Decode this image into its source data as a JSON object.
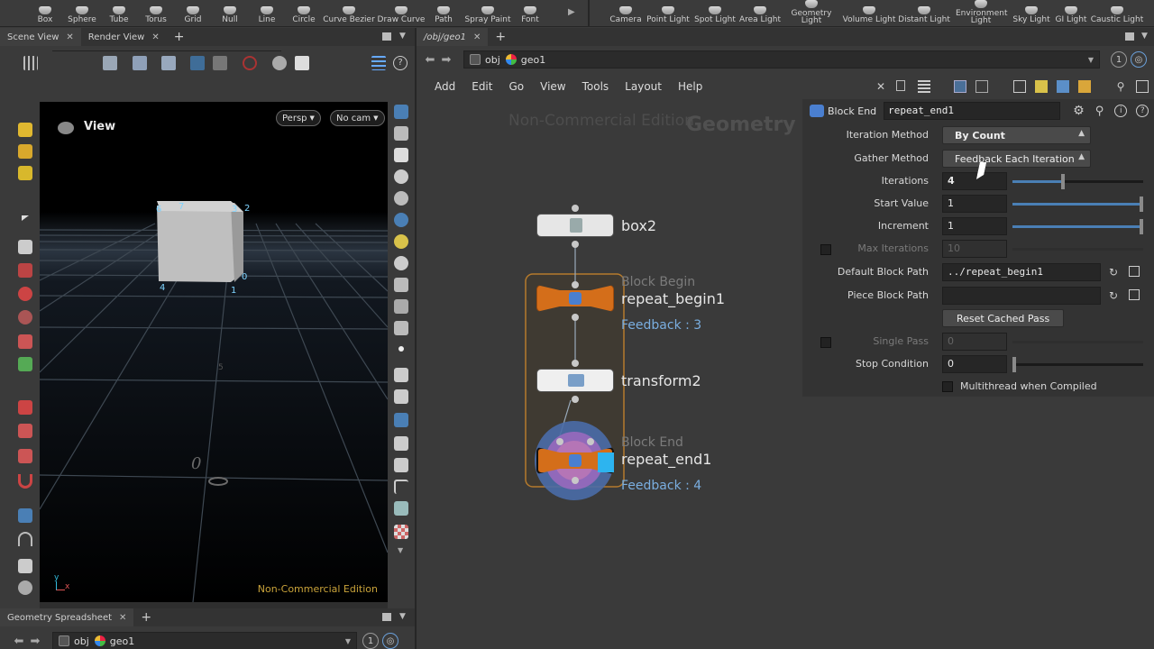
{
  "shelf": {
    "tools": [
      "Box",
      "Sphere",
      "Tube",
      "Torus",
      "Grid",
      "Null",
      "Line",
      "Circle",
      "Curve Bezier",
      "Draw Curve",
      "Path",
      "Spray Paint",
      "Font"
    ],
    "lights": [
      "Camera",
      "Point Light",
      "Spot Light",
      "Area Light",
      "Geometry Light",
      "Volume Light",
      "Distant Light",
      "Environment Light",
      "Sky Light",
      "GI Light",
      "Caustic Light"
    ]
  },
  "left_panel": {
    "tabs": [
      {
        "label": "Scene View"
      },
      {
        "label": "Render View"
      }
    ],
    "path": {
      "root": "obj",
      "node": "geo1",
      "circle": "1"
    },
    "viewport": {
      "label": "View",
      "persp": "Persp",
      "cam": "No cam",
      "watermark": "Non-Commercial Edition",
      "axis_y": "y",
      "axis_x": "x",
      "points": [
        "6",
        "7",
        "3",
        "2",
        "4",
        "1",
        "0"
      ]
    },
    "bottom_tab": "Geometry Spreadsheet",
    "bottom_path": {
      "root": "obj",
      "node": "geo1",
      "circle": "1"
    }
  },
  "right_panel": {
    "tab": "/obj/geo1",
    "path": {
      "root": "obj",
      "node": "geo1",
      "circle": "1"
    },
    "menus": [
      "Add",
      "Edit",
      "Go",
      "View",
      "Tools",
      "Layout",
      "Help"
    ],
    "network": {
      "watermark": "Non-Commercial Edition",
      "context": "Geometry",
      "nodes": {
        "box2": {
          "name": "box2"
        },
        "repeat_begin1": {
          "type": "Block Begin",
          "name": "repeat_begin1",
          "feedback": "Feedback : 3"
        },
        "transform2": {
          "name": "transform2"
        },
        "repeat_end1": {
          "type": "Block End",
          "name": "repeat_end1",
          "feedback": "Feedback : 4"
        }
      }
    },
    "params": {
      "node_type": "Block End",
      "node_name": "repeat_end1",
      "iteration_method": {
        "label": "Iteration Method",
        "value": "By Count"
      },
      "gather_method": {
        "label": "Gather Method",
        "value": "Feedback Each Iteration"
      },
      "iterations": {
        "label": "Iterations",
        "value": "4",
        "fraction": 0.4
      },
      "start_value": {
        "label": "Start Value",
        "value": "1",
        "fraction": 1.0
      },
      "increment": {
        "label": "Increment",
        "value": "1",
        "fraction": 1.0
      },
      "max_iterations": {
        "label": "Max Iterations",
        "value": "10"
      },
      "default_block_path": {
        "label": "Default Block Path",
        "value": "../repeat_begin1"
      },
      "piece_block_path": {
        "label": "Piece Block Path",
        "value": ""
      },
      "reset_button": "Reset Cached Pass",
      "single_pass": {
        "label": "Single Pass",
        "value": "0"
      },
      "stop_condition": {
        "label": "Stop Condition",
        "value": "0"
      },
      "multithread": "Multithread when Compiled"
    }
  }
}
